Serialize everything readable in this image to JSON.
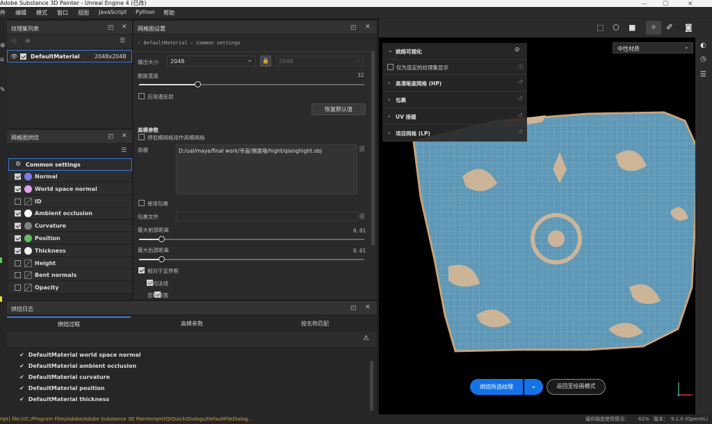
{
  "window": {
    "title": "Adobe Substance 3D Painter - Unreal Engine 4 (已改)"
  },
  "menu": {
    "items": [
      "件",
      "编辑",
      "模式",
      "窗口",
      "视图",
      "JavaScript",
      "Python",
      "帮助"
    ]
  },
  "texture_set_list": {
    "title": "纹理集列表",
    "material": "DefaultMaterial",
    "resolution": "2048x2048"
  },
  "baker": {
    "title": "网格图烘焙",
    "common": "Common settings",
    "items": [
      {
        "label": "Normal",
        "checked": true,
        "color": "#7e7aef"
      },
      {
        "label": "World space normal",
        "checked": true,
        "color": "#e0a0f0"
      },
      {
        "label": "ID",
        "checked": false,
        "color": ""
      },
      {
        "label": "Ambient occlusion",
        "checked": true,
        "color": "#ffffff"
      },
      {
        "label": "Curvature",
        "checked": true,
        "color": "#808080"
      },
      {
        "label": "Position",
        "checked": true,
        "color": "#60c060"
      },
      {
        "label": "Thickness",
        "checked": true,
        "color": "#f0f0f0"
      },
      {
        "label": "Height",
        "checked": false,
        "color": ""
      },
      {
        "label": "Bent normals",
        "checked": false,
        "color": ""
      },
      {
        "label": "Opacity",
        "checked": false,
        "color": ""
      }
    ]
  },
  "settings": {
    "title": "网格图设置",
    "breadcrumb_a": "DefaultMaterial",
    "breadcrumb_b": "Common settings",
    "output_size_label": "输出大小",
    "output_size": "2048",
    "output_size_locked": "2048",
    "dilation_label": "膨胀宽度",
    "dilation_value": "32",
    "dilation_fraction": 0.26,
    "apply_diffusion": "应用漫反射",
    "reset_button": "恢复默认值",
    "highpoly_section": "高模参数",
    "use_lowpoly_as_high": "将低模网格用作高模网格",
    "highpoly_label": "高模",
    "highpoly_path": "D:/ual/maya/final work/寺庙/侧面墙/hight/qianghight.obj",
    "use_cage": "使用包裹",
    "cage_file_label": "包裹文件",
    "max_front_label": "最大前部距离",
    "max_front_value": "0.01",
    "max_front_fraction": 0.01,
    "max_rear_label": "最大后部距离",
    "max_rear_value": "0.01",
    "max_rear_fraction": 0.01,
    "relative_bbox": "相对于定界框",
    "average_normals": "平均法线",
    "ignore_backface": "忽略背面"
  },
  "log": {
    "title": "烘焙日志",
    "tabs": [
      "烘焙过程",
      "高模参数",
      "按名称匹配"
    ],
    "lines": [
      "DefaultMaterial world space normal",
      "DefaultMaterial ambient occlusion",
      "DefaultMaterial curvature",
      "DefaultMaterial position",
      "DefaultMaterial thickness"
    ]
  },
  "viewport": {
    "material_mode": "中性材质",
    "panel": {
      "title": "烘焙可视化",
      "only_selected": "仅为选定的纹理集显示",
      "rows": [
        "高清晰度网格 (HP)",
        "包裹",
        "UV 接缝",
        "项目网格 (LP)"
      ]
    },
    "bake_button": "烘焙所选纹理",
    "return_button": "返回至绘画模式"
  },
  "status": {
    "left": "ript] file:///C:/Program Files/Adobe/Adobe Substance 3D Painter/qml/QtQuick/Dialogs/DefaultFileDialog…",
    "disk_label": "缓存磁盘使用情况：",
    "disk_value": "62%",
    "version_label": "版本：",
    "version": "9.1.0 (OpenGL)"
  }
}
